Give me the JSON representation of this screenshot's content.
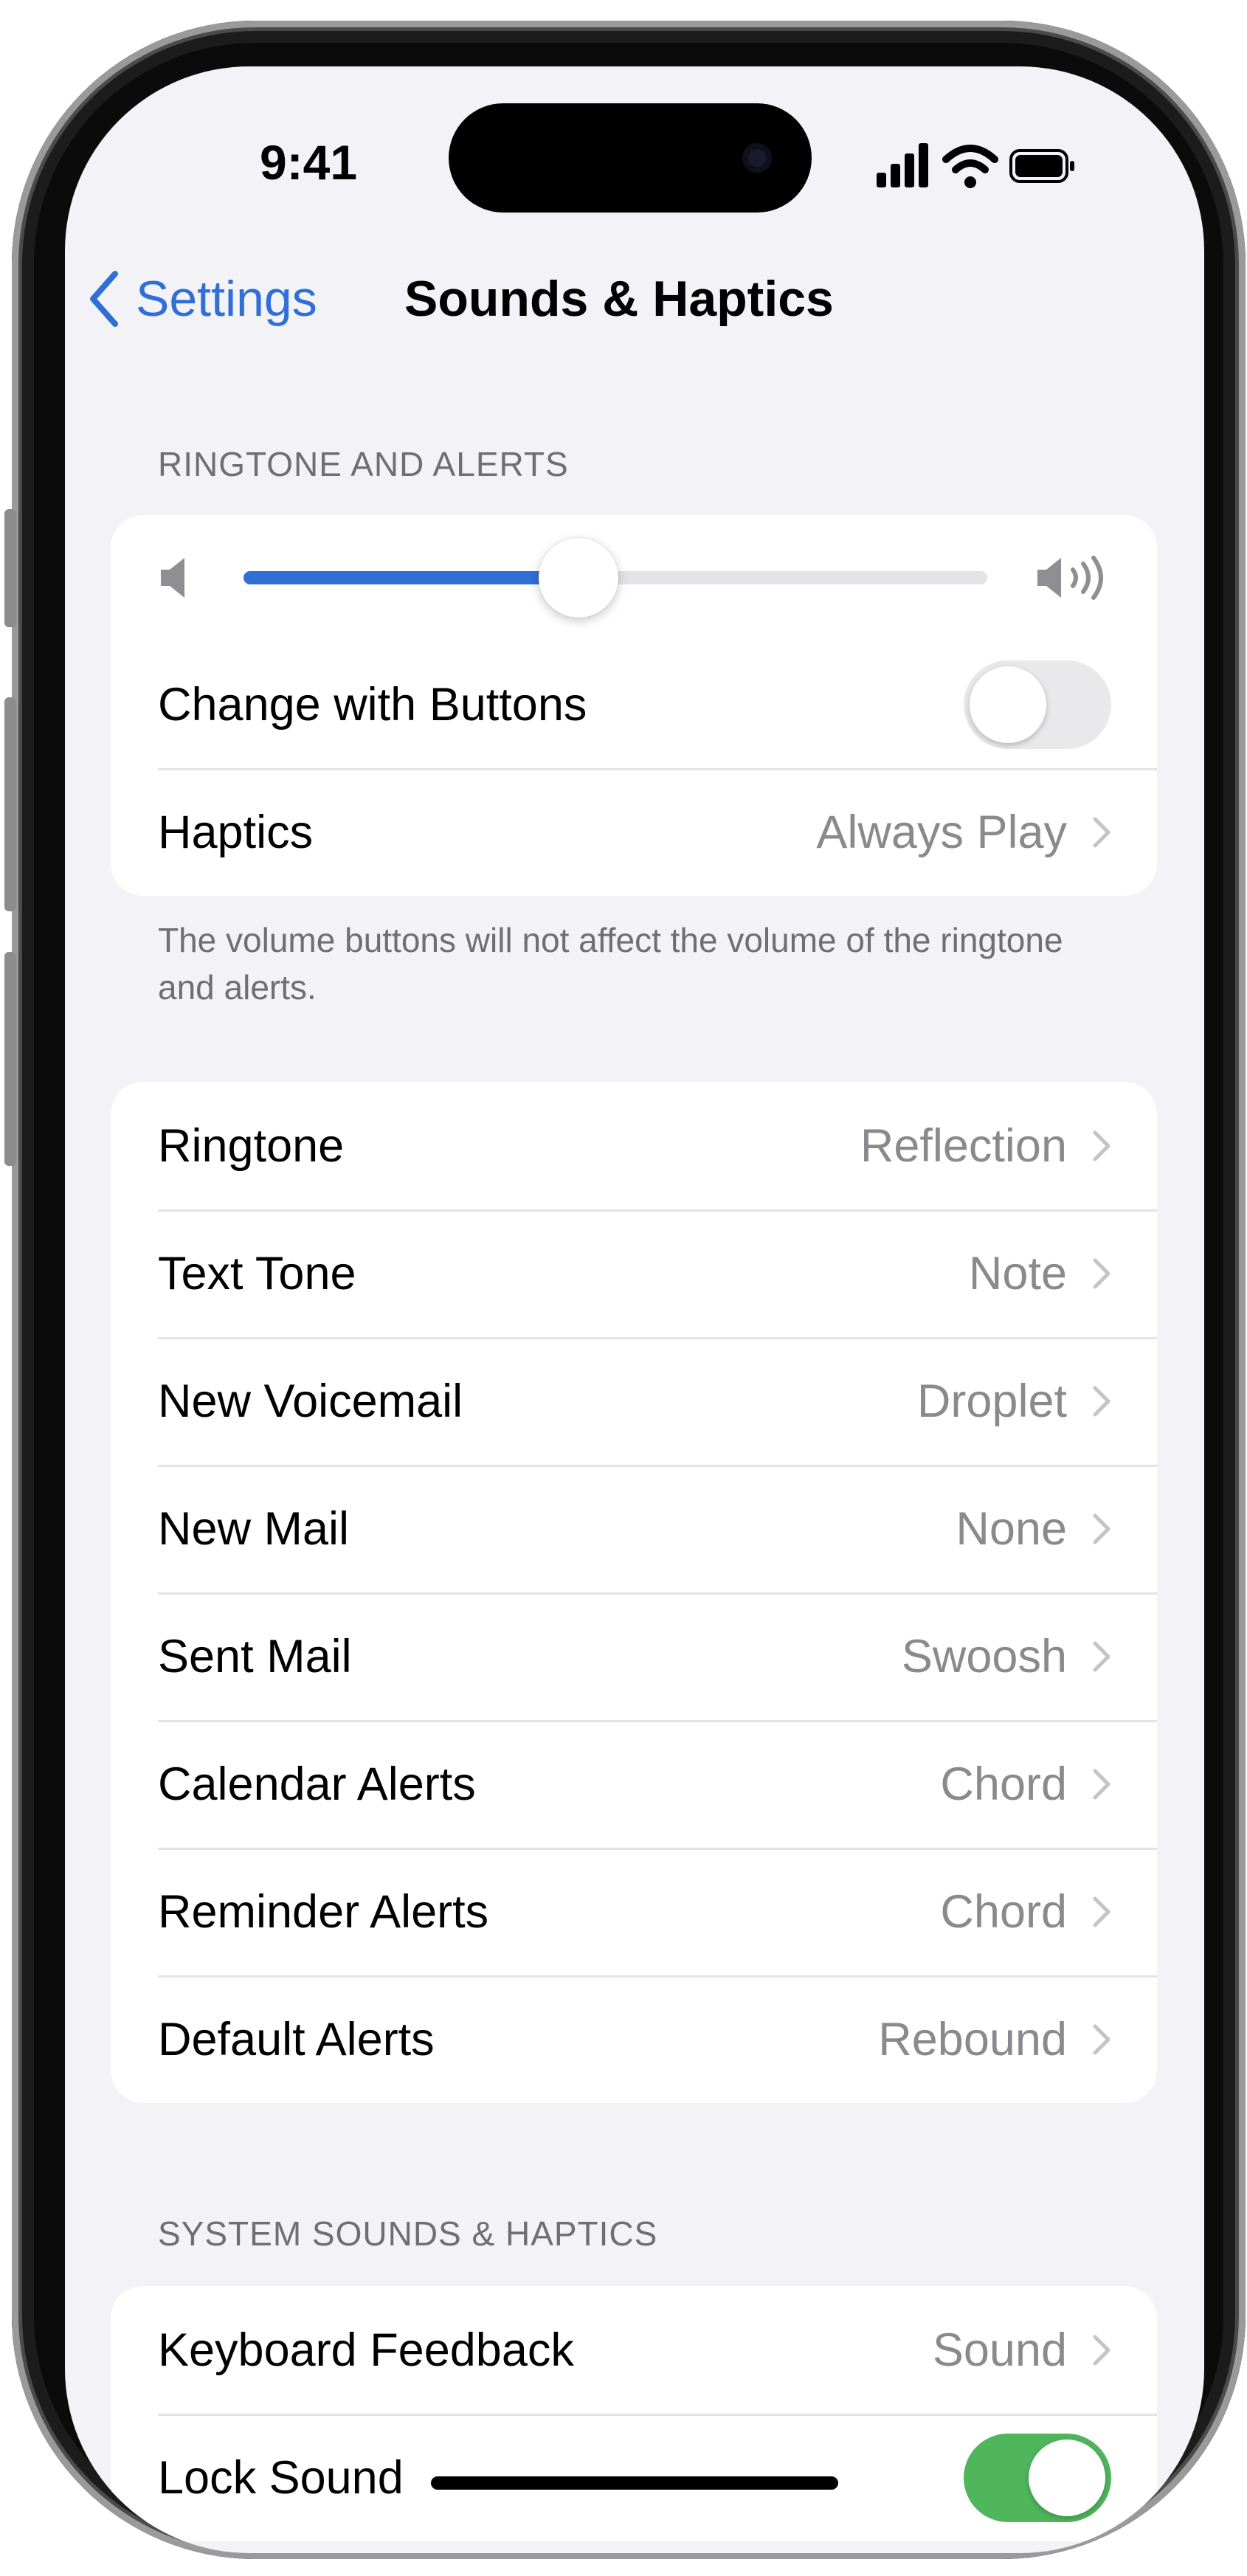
{
  "status_bar": {
    "time": "9:41"
  },
  "nav": {
    "back_label": "Settings",
    "title": "Sounds & Haptics"
  },
  "ringtone_section": {
    "header": "RINGTONE AND ALERTS",
    "volume_level": 0.45,
    "change_with_buttons": {
      "label": "Change with Buttons",
      "on": false
    },
    "haptics": {
      "label": "Haptics",
      "value": "Always Play"
    },
    "footer": "The volume buttons will not affect the volume of the ringtone and alerts."
  },
  "tones": [
    {
      "label": "Ringtone",
      "value": "Reflection"
    },
    {
      "label": "Text Tone",
      "value": "Note"
    },
    {
      "label": "New Voicemail",
      "value": "Droplet"
    },
    {
      "label": "New Mail",
      "value": "None"
    },
    {
      "label": "Sent Mail",
      "value": "Swoosh"
    },
    {
      "label": "Calendar Alerts",
      "value": "Chord"
    },
    {
      "label": "Reminder Alerts",
      "value": "Chord"
    },
    {
      "label": "Default Alerts",
      "value": "Rebound"
    }
  ],
  "system_section": {
    "header": "SYSTEM SOUNDS & HAPTICS",
    "keyboard_feedback": {
      "label": "Keyboard Feedback",
      "value": "Sound"
    },
    "lock_sound": {
      "label": "Lock Sound",
      "on": true
    }
  },
  "colors": {
    "accent": "#2f6fd6",
    "toggle_on": "#4fb65c",
    "background": "#f2f2f7"
  },
  "icons": [
    "back-chevron-icon",
    "cellular-signal-icon",
    "wifi-icon",
    "battery-icon",
    "volume-low-icon",
    "volume-high-icon",
    "chevron-right-icon"
  ]
}
